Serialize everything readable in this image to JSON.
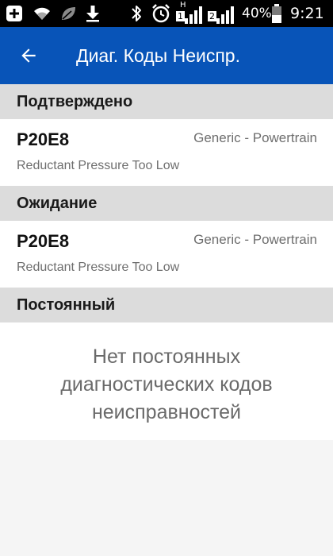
{
  "status_bar": {
    "battery_percent": "40%",
    "time": "9:21",
    "signal_sim1": "1",
    "signal_sim2": "2",
    "network_type": "H",
    "icons": [
      "plus-box-icon",
      "wifi-icon",
      "leaf-icon",
      "download-icon",
      "bluetooth-icon",
      "alarm-icon",
      "signal-icon",
      "battery-icon"
    ]
  },
  "app_bar": {
    "title": "Диаг. Коды Неиспр.",
    "back_icon": "arrow-back-icon"
  },
  "sections": [
    {
      "header": "Подтверждено",
      "codes": [
        {
          "code": "P20E8",
          "type": "Generic - Powertrain",
          "description": "Reductant Pressure Too Low"
        }
      ]
    },
    {
      "header": "Ожидание",
      "codes": [
        {
          "code": "P20E8",
          "type": "Generic - Powertrain",
          "description": "Reductant Pressure Too Low"
        }
      ]
    },
    {
      "header": "Постоянный",
      "empty_message": "Нет постоянных диагностических кодов неисправностей"
    }
  ],
  "colors": {
    "app_bar": "#0854b8",
    "section_header": "#dcdcdc",
    "background": "#f5f5f5"
  }
}
